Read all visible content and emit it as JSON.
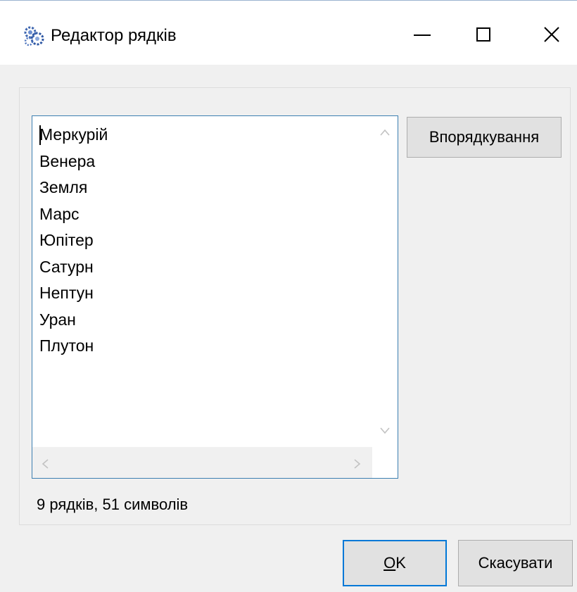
{
  "window": {
    "title": "Редактор рядків",
    "icon": "gears-app-icon",
    "controls": [
      "minimize-icon",
      "maximize-icon",
      "close-icon"
    ]
  },
  "editor": {
    "lines": [
      "Меркурій",
      "Венера",
      "Земля",
      "Марс",
      "Юпітер",
      "Сатурн",
      "Нептун",
      "Уран",
      "Плутон"
    ]
  },
  "buttons": {
    "sort_label": "Впорядкування",
    "ok_accel": "O",
    "ok_rest": "K",
    "cancel_label": "Скасувати"
  },
  "status": {
    "text": "9 рядків, 51 символів"
  },
  "colors": {
    "accent": "#0078d7",
    "memo_border": "#3c7fb1",
    "background": "#f0f0f0"
  }
}
